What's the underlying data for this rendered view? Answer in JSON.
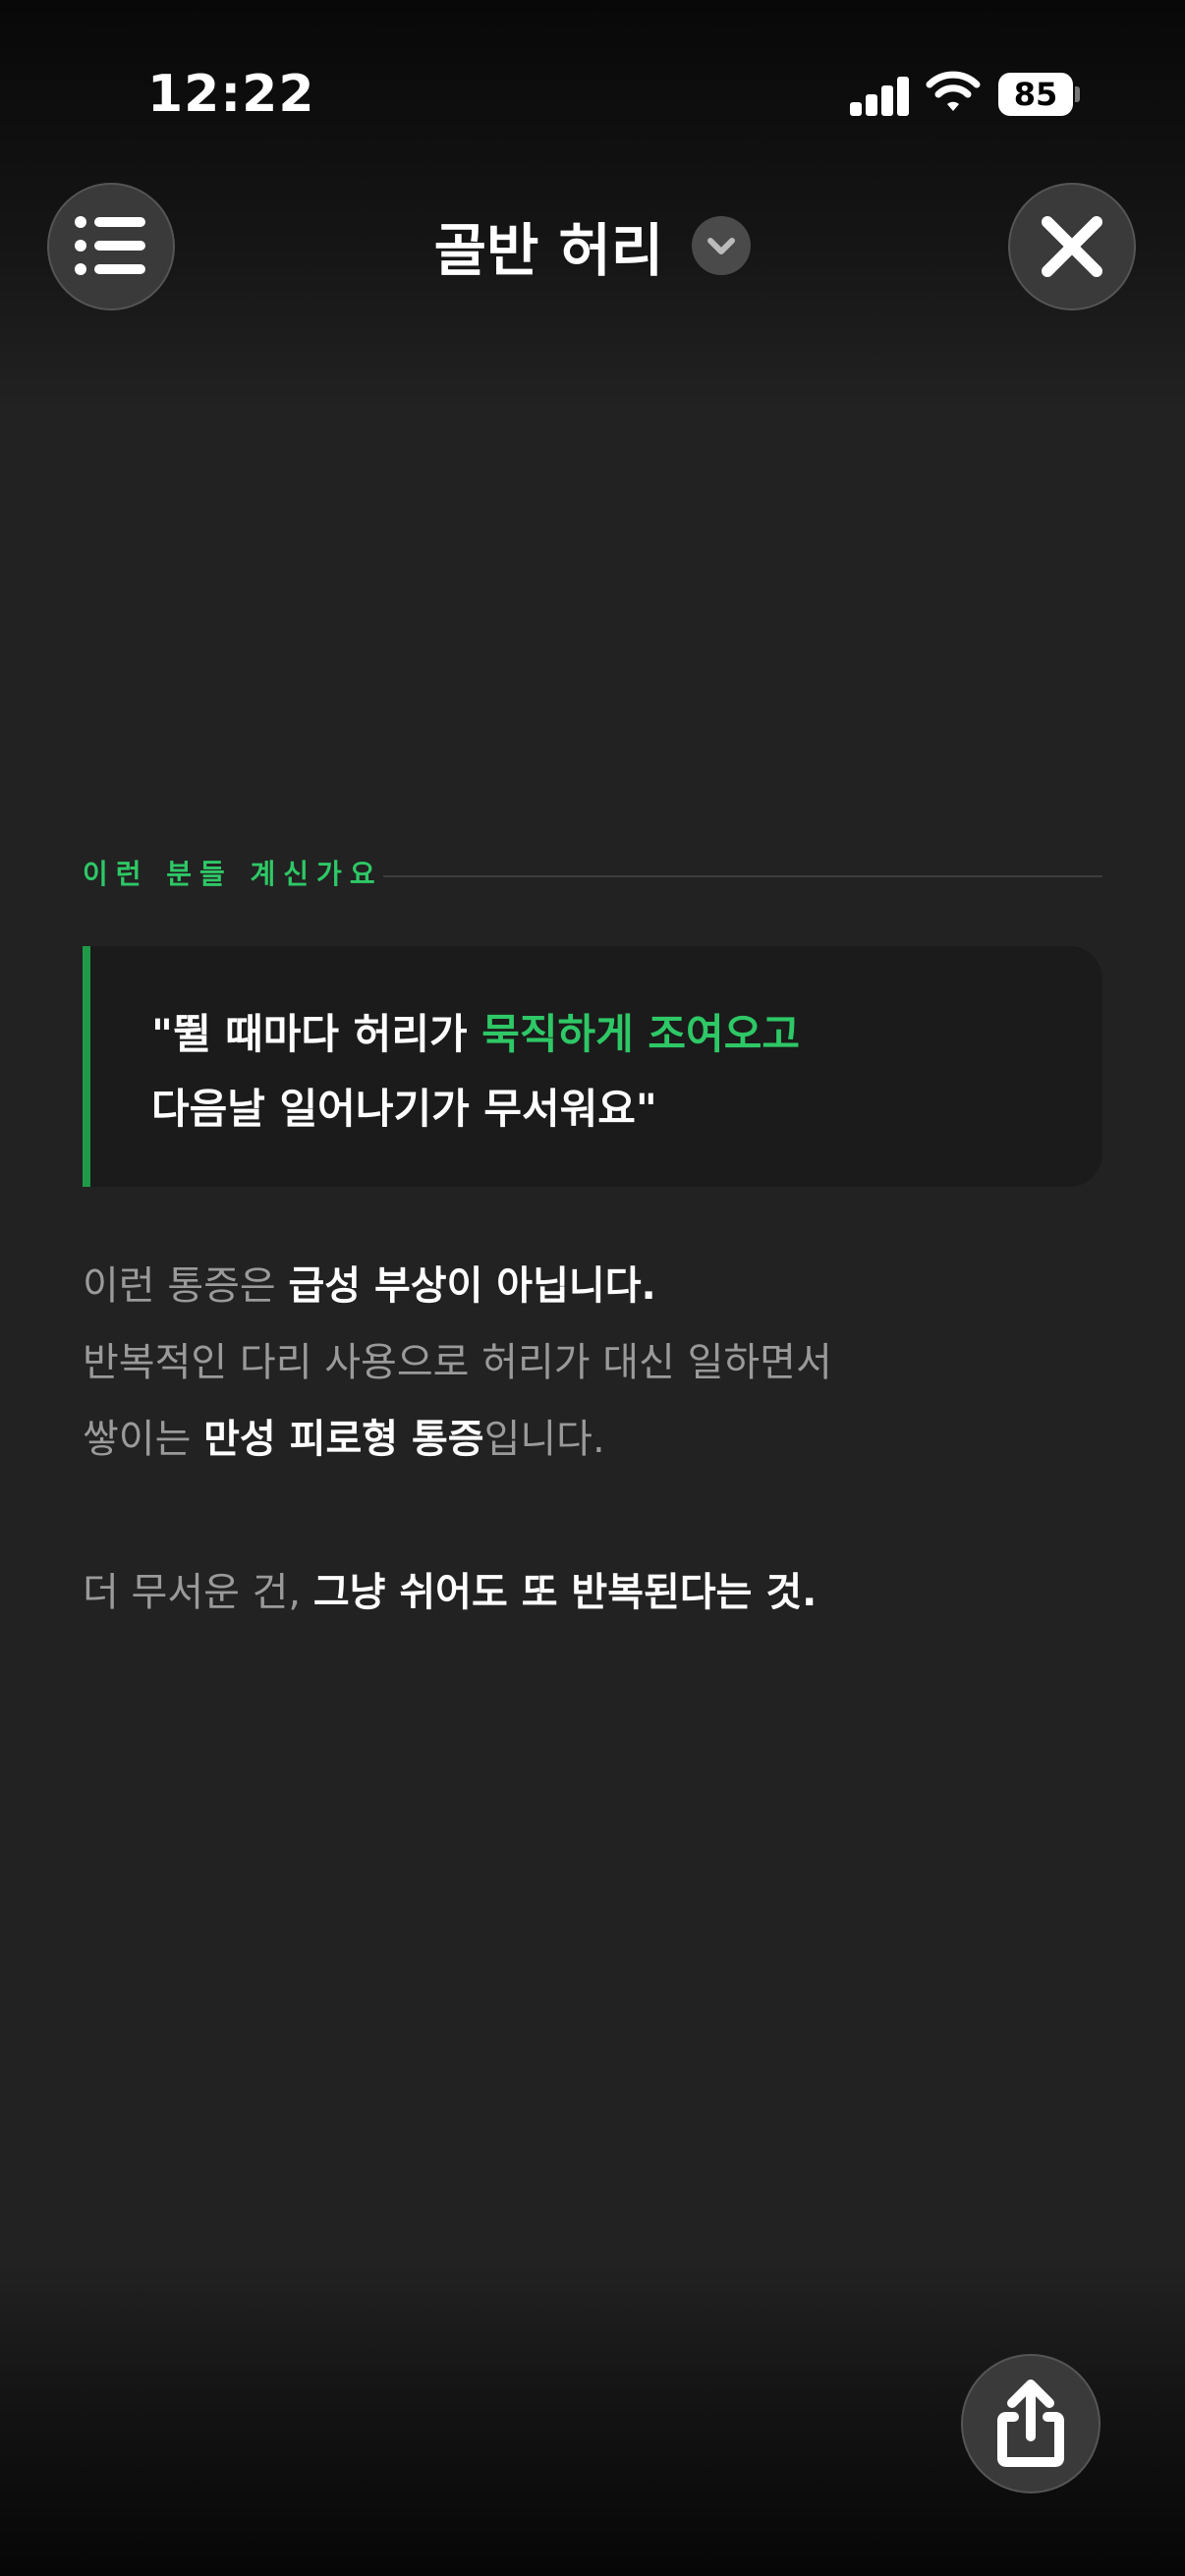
{
  "status_bar": {
    "time": "12:22",
    "battery": "85",
    "signal_icon": "signal-bars-icon",
    "wifi_icon": "wifi-icon"
  },
  "header": {
    "title": "골반 허리",
    "menu_icon": "list-icon",
    "dropdown_icon": "chevron-down-icon",
    "close_icon": "close-icon"
  },
  "section": {
    "label": "이런 분들 계신가요"
  },
  "quote": {
    "line1_prefix": "\"뛸 때마다 허리가 ",
    "line1_highlight": "묵직하게 조여오고",
    "line2": "다음날 일어나기가 무서워요\""
  },
  "body": {
    "p1_plain": "이런 통증은 ",
    "p1_bold": "급성 부상이 아닙니다.",
    "p2": "반복적인 다리 사용으로 허리가 대신 일하면서",
    "p3_plain_a": "쌓이는 ",
    "p3_bold": "만성 피로형 통증",
    "p3_plain_b": "입니다.",
    "p4_plain": "더 무서운 건, ",
    "p4_bold": "그냥 쉬어도 또 반복된다는 것."
  },
  "footer": {
    "share_icon": "share-icon"
  },
  "colors": {
    "accent_green": "#2ec866",
    "background": "#222222"
  }
}
